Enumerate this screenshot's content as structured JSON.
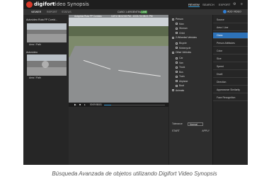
{
  "app": {
    "brand": "digifort",
    "product": "Video Synopsis",
    "top_nav": [
      "REVIEW",
      "SEARCH",
      "EXPORT"
    ],
    "top_nav_active": "REVIEW"
  },
  "subbar": {
    "tabs": [
      "VIEWER",
      "REPORT",
      "STATUS"
    ],
    "camera_title": "CASO 1 ARGENTINA",
    "live_badge": "LIVE",
    "add_video": "ADD VIDEO"
  },
  "left_panel": {
    "group1": "Autovideo Ruta FP Corrid...",
    "thumb1_caption": "Area / Path",
    "group2": "Autovideo",
    "thumb2_caption": "Area / Path"
  },
  "video": {
    "overlay_title": "Autopista Ruta FP Corridos",
    "overlay_time": "12/21/ 08:02:53 PM - 12/21/ 04:08:21 PM",
    "time": "00:09:58.81"
  },
  "filters": {
    "items": [
      {
        "label": "Person",
        "level": 0
      },
      {
        "label": "Man",
        "level": 1
      },
      {
        "label": "Woman",
        "level": 1
      },
      {
        "label": "Child",
        "level": 1
      },
      {
        "label": "2-Wheeled Vehicles",
        "level": 0
      },
      {
        "label": "Bicycle",
        "level": 1
      },
      {
        "label": "Motorcycle",
        "level": 1
      },
      {
        "label": "Other Vehicles",
        "level": 0
      },
      {
        "label": "Car",
        "level": 1
      },
      {
        "label": "Van",
        "level": 1
      },
      {
        "label": "Truck",
        "level": 1
      },
      {
        "label": "Bus",
        "level": 1
      },
      {
        "label": "Train",
        "level": 1
      },
      {
        "label": "Airplane",
        "level": 1
      },
      {
        "label": "Boat",
        "level": 1
      },
      {
        "label": "Animals",
        "level": 0
      }
    ],
    "tolerance_label": "Tolerance",
    "tolerance_value": "Normal",
    "start_label": "START",
    "start_value": "APPLY"
  },
  "right_panel": {
    "items": [
      "Source",
      "Area / Line",
      "Class",
      "Person Attributes",
      "Color",
      "Size",
      "Speed",
      "Dwell",
      "Direction",
      "Appearance Similarity",
      "Face Recognition"
    ],
    "selected": "Class"
  },
  "caption": "Búsqueda Avanzada de objetos utilizando Digifort Video Synopsis"
}
